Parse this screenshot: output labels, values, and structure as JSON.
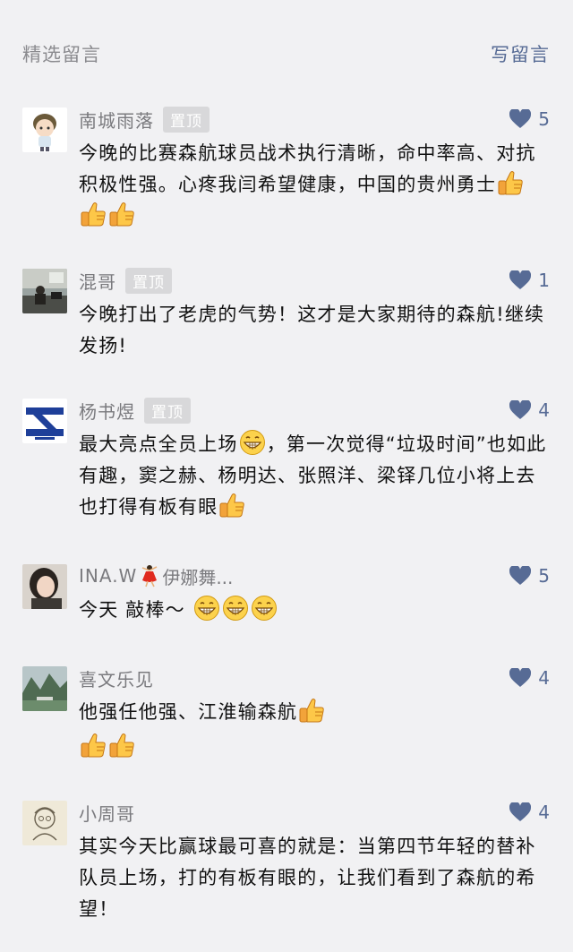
{
  "header": {
    "title": "精选留言",
    "write_label": "写留言"
  },
  "colors": {
    "background": "#f1f1f3",
    "link": "#576b95",
    "muted": "#7a7a7e",
    "badge": "#d8d8da"
  },
  "comments": [
    {
      "nickname": "南城雨落",
      "pinned_label": "置顶",
      "likes": "5",
      "text": "今晚的比赛森航球员战术执行清晰，命中率高、对抗积极性强。心疼我闫希望健康，中国的贵州勇士",
      "avatar_icon": "cartoon-avatar",
      "emojis": [
        "thumbs-up",
        "thumbs-up",
        "thumbs-up"
      ]
    },
    {
      "nickname": "混哥",
      "pinned_label": "置顶",
      "likes": "1",
      "text": "今晚打出了老虎的气势！这才是大家期待的森航!继续发扬!",
      "avatar_icon": "office-photo-avatar"
    },
    {
      "nickname": "杨书煜",
      "pinned_label": "置顶",
      "likes": "4",
      "text_before": "最大亮点全员上场",
      "text_after": "，第一次觉得“垃圾时间”也如此有趣，窦之赫、杨明达、张照洋、梁铎几位小将上去也打得有板有眼",
      "avatar_icon": "logo-avatar",
      "emojis": [
        "grin",
        "thumbs-up"
      ]
    },
    {
      "nickname": "INA.W",
      "nickname_rest": "伊娜舞...",
      "likes": "5",
      "text": "今天 敲棒～",
      "avatar_icon": "portrait-avatar",
      "emojis": [
        "grin",
        "grin",
        "grin"
      ]
    },
    {
      "nickname": "喜文乐见",
      "likes": "4",
      "text": "他强任他强、江淮输森航",
      "avatar_icon": "landscape-avatar",
      "emojis": [
        "thumbs-up",
        "thumbs-up",
        "thumbs-up"
      ]
    },
    {
      "nickname": "小周哥",
      "likes": "4",
      "text": "其实今天比赢球最可喜的就是：当第四节年轻的替补队员上场，打的有板有眼的，让我们看到了森航的希望！",
      "avatar_icon": "sketch-avatar"
    }
  ]
}
